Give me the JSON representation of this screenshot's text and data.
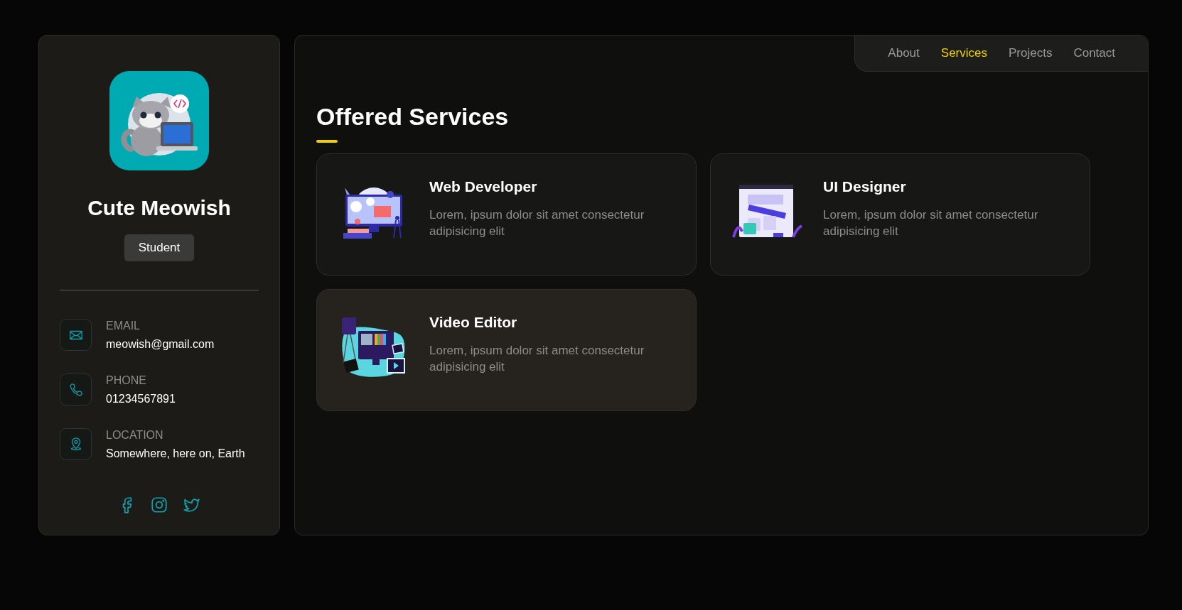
{
  "profile": {
    "name": "Cute Meowish",
    "role": "Student"
  },
  "contacts": [
    {
      "kind": "email",
      "label": "EMAIL",
      "value": "meowish@gmail.com"
    },
    {
      "kind": "phone",
      "label": "PHONE",
      "value": "01234567891"
    },
    {
      "kind": "location",
      "label": "LOCATION",
      "value": "Somewhere, here on, Earth"
    }
  ],
  "socials": [
    {
      "kind": "facebook"
    },
    {
      "kind": "instagram"
    },
    {
      "kind": "twitter"
    }
  ],
  "nav": [
    {
      "label": "About",
      "selected": false
    },
    {
      "label": "Services",
      "selected": true
    },
    {
      "label": "Projects",
      "selected": false
    },
    {
      "label": "Contact",
      "selected": false
    }
  ],
  "section_title": "Offered Services",
  "services": [
    {
      "kind": "web",
      "title": "Web Developer",
      "text": "Lorem, ipsum dolor sit amet consectetur adipisicing elit",
      "highlighted": false
    },
    {
      "kind": "ui",
      "title": "UI Designer",
      "text": "Lorem, ipsum dolor sit amet consectetur adipisicing elit",
      "highlighted": false
    },
    {
      "kind": "video",
      "title": "Video Editor",
      "text": "Lorem, ipsum dolor sit amet consectetur adipisicing elit",
      "highlighted": true
    }
  ]
}
